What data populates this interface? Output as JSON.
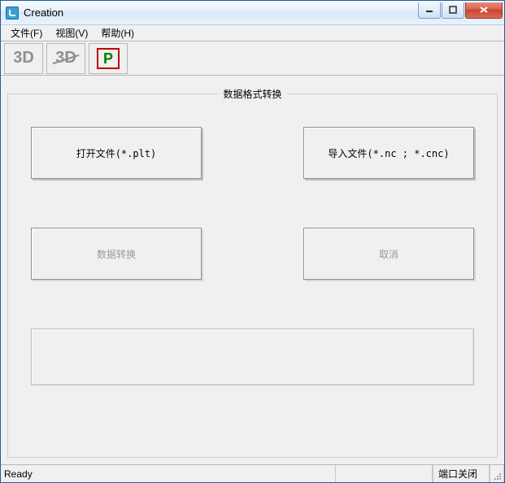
{
  "window": {
    "title": "Creation"
  },
  "menu": {
    "file": "文件(F)",
    "view": "视图(V)",
    "help": "帮助(H)"
  },
  "toolbar": {
    "btn3d": "3D",
    "btn3d_off": "3D",
    "btnP": "P"
  },
  "group": {
    "title": "数据格式转换",
    "open_file": "打开文件(*.plt)",
    "import_file": "导入文件(*.nc ; *.cnc)",
    "convert": "数据转换",
    "cancel": "取消"
  },
  "status": {
    "ready": "Ready",
    "port": "端口关闭"
  }
}
